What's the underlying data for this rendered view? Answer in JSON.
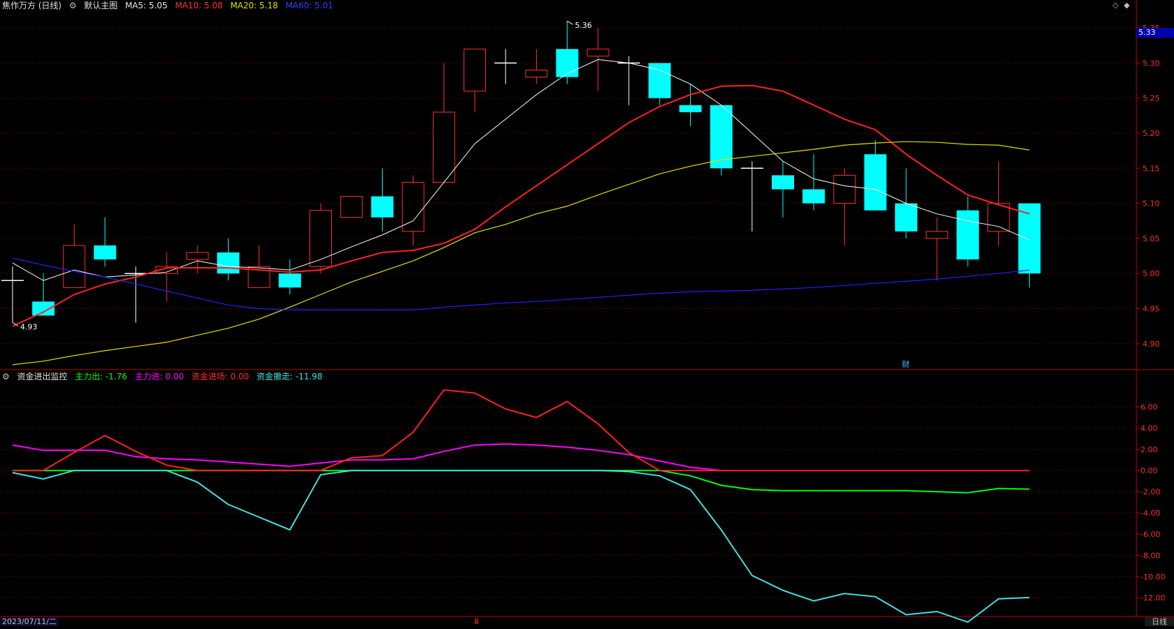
{
  "header": {
    "title": "焦作万方 (日线)",
    "main_chart_label": "默认主图",
    "ma5": "MA5: 5.05",
    "ma10": "MA10: 5.08",
    "ma20": "MA20: 5.18",
    "ma60": "MA60: 5.01"
  },
  "indicator_header": {
    "name": "资金进出监控",
    "main_out": "主力出: -1.76",
    "main_in": "主力进: 0.00",
    "fund_in": "资金进场: 0.00",
    "fund_out": "资金撤走: -11.98"
  },
  "current_price": "5.33",
  "high_annotation": "5.36",
  "low_annotation": "4.93",
  "finance_marker": "财",
  "bottom_bar": {
    "date": "2023/07/11/二",
    "month_marker": "8",
    "period": "日线"
  },
  "colors": {
    "up": "#ff3030",
    "down": "#00ffff",
    "ma5": "#ffffff",
    "ma10": "#ff2020",
    "ma20": "#e0e000",
    "ma60": "#2020ff",
    "main_out": "#00ff00",
    "main_in": "#ff00ff",
    "fund_in": "#ff2020",
    "fund_out": "#40e0e0",
    "axis": "#c00000"
  },
  "chart_data": [
    {
      "type": "candlestick",
      "title": "焦作万方 (日线)",
      "y_ticks": [
        4.9,
        4.95,
        5.0,
        5.05,
        5.1,
        5.15,
        5.2,
        5.25,
        5.3,
        5.35
      ],
      "y_tick_labels": [
        "4.90",
        "4.95",
        "5.00",
        "5.05",
        "5.10",
        "5.15",
        "5.20",
        "5.25",
        "5.30",
        "5.35"
      ],
      "ylim": [
        4.865,
        5.37
      ],
      "candles": [
        {
          "o": 4.99,
          "h": 5.01,
          "l": 4.93,
          "c": 4.99
        },
        {
          "o": 4.96,
          "h": 5.0,
          "l": 4.94,
          "c": 4.94
        },
        {
          "o": 4.98,
          "h": 5.07,
          "l": 4.98,
          "c": 5.04
        },
        {
          "o": 5.04,
          "h": 5.08,
          "l": 5.01,
          "c": 5.02
        },
        {
          "o": 5.0,
          "h": 5.01,
          "l": 4.93,
          "c": 5.0
        },
        {
          "o": 5.0,
          "h": 5.03,
          "l": 4.96,
          "c": 5.01
        },
        {
          "o": 5.02,
          "h": 5.04,
          "l": 5.0,
          "c": 5.03
        },
        {
          "o": 5.03,
          "h": 5.05,
          "l": 4.99,
          "c": 5.0
        },
        {
          "o": 4.98,
          "h": 5.04,
          "l": 4.98,
          "c": 5.01
        },
        {
          "o": 5.0,
          "h": 5.02,
          "l": 4.97,
          "c": 4.98
        },
        {
          "o": 5.01,
          "h": 5.1,
          "l": 5.0,
          "c": 5.09
        },
        {
          "o": 5.08,
          "h": 5.11,
          "l": 5.08,
          "c": 5.11
        },
        {
          "o": 5.11,
          "h": 5.15,
          "l": 5.06,
          "c": 5.08
        },
        {
          "o": 5.06,
          "h": 5.14,
          "l": 5.04,
          "c": 5.13
        },
        {
          "o": 5.13,
          "h": 5.3,
          "l": 5.13,
          "c": 5.23
        },
        {
          "o": 5.26,
          "h": 5.32,
          "l": 5.23,
          "c": 5.32
        },
        {
          "o": 5.3,
          "h": 5.32,
          "l": 5.27,
          "c": 5.3
        },
        {
          "o": 5.28,
          "h": 5.32,
          "l": 5.27,
          "c": 5.29
        },
        {
          "o": 5.32,
          "h": 5.36,
          "l": 5.27,
          "c": 5.28
        },
        {
          "o": 5.31,
          "h": 5.35,
          "l": 5.26,
          "c": 5.32
        },
        {
          "o": 5.3,
          "h": 5.31,
          "l": 5.24,
          "c": 5.3
        },
        {
          "o": 5.3,
          "h": 5.3,
          "l": 5.24,
          "c": 5.25
        },
        {
          "o": 5.24,
          "h": 5.27,
          "l": 5.21,
          "c": 5.23
        },
        {
          "o": 5.24,
          "h": 5.24,
          "l": 5.14,
          "c": 5.15
        },
        {
          "o": 5.15,
          "h": 5.16,
          "l": 5.06,
          "c": 5.15
        },
        {
          "o": 5.14,
          "h": 5.16,
          "l": 5.08,
          "c": 5.12
        },
        {
          "o": 5.12,
          "h": 5.17,
          "l": 5.09,
          "c": 5.1
        },
        {
          "o": 5.1,
          "h": 5.15,
          "l": 5.04,
          "c": 5.14
        },
        {
          "o": 5.17,
          "h": 5.19,
          "l": 5.09,
          "c": 5.09
        },
        {
          "o": 5.1,
          "h": 5.15,
          "l": 5.05,
          "c": 5.06
        },
        {
          "o": 5.05,
          "h": 5.08,
          "l": 4.99,
          "c": 5.06
        },
        {
          "o": 5.09,
          "h": 5.11,
          "l": 5.01,
          "c": 5.02
        },
        {
          "o": 5.06,
          "h": 5.16,
          "l": 5.04,
          "c": 5.1
        },
        {
          "o": 5.1,
          "h": 5.1,
          "l": 4.98,
          "c": 5.0
        }
      ],
      "series": [
        {
          "name": "MA5",
          "values": [
            5.015,
            4.99,
            5.005,
            4.995,
            4.998,
            5.002,
            5.018,
            5.01,
            5.008,
            5.005,
            5.02,
            5.038,
            5.055,
            5.075,
            5.13,
            5.185,
            5.22,
            5.255,
            5.285,
            5.305,
            5.3,
            5.29,
            5.27,
            5.24,
            5.2,
            5.16,
            5.135,
            5.125,
            5.12,
            5.1,
            5.085,
            5.075,
            5.067,
            5.048
          ]
        },
        {
          "name": "MA10",
          "values": [
            4.925,
            4.945,
            4.97,
            4.985,
            4.995,
            5.008,
            5.008,
            5.008,
            5.005,
            5.002,
            5.005,
            5.018,
            5.03,
            5.033,
            5.043,
            5.063,
            5.095,
            5.125,
            5.155,
            5.185,
            5.215,
            5.238,
            5.255,
            5.267,
            5.268,
            5.26,
            5.24,
            5.22,
            5.205,
            5.17,
            5.14,
            5.112,
            5.098,
            5.085
          ]
        },
        {
          "name": "MA20",
          "values": [
            4.87,
            4.875,
            4.883,
            4.89,
            4.896,
            4.902,
            4.912,
            4.922,
            4.935,
            4.952,
            4.97,
            4.988,
            5.003,
            5.018,
            5.037,
            5.058,
            5.07,
            5.085,
            5.096,
            5.112,
            5.127,
            5.142,
            5.153,
            5.162,
            5.167,
            5.172,
            5.177,
            5.183,
            5.186,
            5.188,
            5.187,
            5.184,
            5.183,
            5.176
          ]
        },
        {
          "name": "MA60",
          "values": [
            5.022,
            5.012,
            5.003,
            4.995,
            4.985,
            4.975,
            4.965,
            4.955,
            4.95,
            4.948,
            4.948,
            4.948,
            4.948,
            4.948,
            4.952,
            4.955,
            4.958,
            4.96,
            4.963,
            4.966,
            4.969,
            4.972,
            4.974,
            4.975,
            4.976,
            4.978,
            4.98,
            4.983,
            4.986,
            4.989,
            4.992,
            4.996,
            5.0,
            5.005
          ]
        }
      ]
    },
    {
      "type": "line",
      "title": "资金进出监控",
      "y_ticks": [
        -12,
        -10,
        -8,
        -6,
        -4,
        -2,
        0,
        2,
        4,
        6
      ],
      "y_tick_labels": [
        "-12.00",
        "-10.00",
        "-8.00",
        "-6.00",
        "-4.00",
        "-2.00",
        "0.00",
        "2.00",
        "4.00",
        "6.00"
      ],
      "ylim": [
        -13.5,
        8.2
      ],
      "series": [
        {
          "name": "主力出",
          "values": [
            0,
            0,
            0,
            0,
            0,
            0,
            0,
            0,
            0,
            0,
            0,
            0,
            0,
            0,
            0,
            0,
            0,
            0,
            0,
            0,
            0,
            0,
            -0.5,
            -1.4,
            -1.8,
            -1.9,
            -1.9,
            -1.9,
            -1.9,
            -1.9,
            -2.0,
            -2.1,
            -1.7,
            -1.76
          ]
        },
        {
          "name": "主力进",
          "values": [
            2.4,
            1.9,
            1.9,
            1.9,
            1.3,
            1.1,
            1.0,
            0.8,
            0.6,
            0.4,
            0.7,
            1.0,
            1.0,
            1.1,
            1.8,
            2.4,
            2.5,
            2.4,
            2.2,
            1.9,
            1.5,
            0.9,
            0.3,
            0.0,
            null,
            null,
            null,
            null,
            null,
            null,
            null,
            null,
            null,
            null
          ]
        },
        {
          "name": "资金进场",
          "values": [
            0.0,
            0.0,
            1.7,
            3.3,
            1.8,
            0.5,
            0.0,
            0.0,
            0.0,
            0.0,
            0.0,
            1.2,
            1.4,
            3.6,
            7.6,
            7.3,
            5.8,
            5.0,
            6.5,
            4.4,
            1.7,
            0.0,
            0.0,
            0.0,
            0.0,
            0.0,
            0.0,
            0.0,
            0.0,
            0.0,
            0.0,
            0.0,
            0.0,
            0.0
          ]
        },
        {
          "name": "资金撤走",
          "values": [
            -0.2,
            -0.8,
            0.0,
            0.0,
            0.0,
            0.0,
            -1.1,
            -3.2,
            -4.4,
            -5.6,
            -0.4,
            0.0,
            0.0,
            0.0,
            0.0,
            0.0,
            0.0,
            0.0,
            0.0,
            0.0,
            -0.1,
            -0.5,
            -1.8,
            -5.6,
            -9.9,
            -11.3,
            -12.3,
            -11.6,
            -11.9,
            -13.6,
            -13.3,
            -14.3,
            -12.1,
            -11.98
          ]
        }
      ]
    }
  ]
}
